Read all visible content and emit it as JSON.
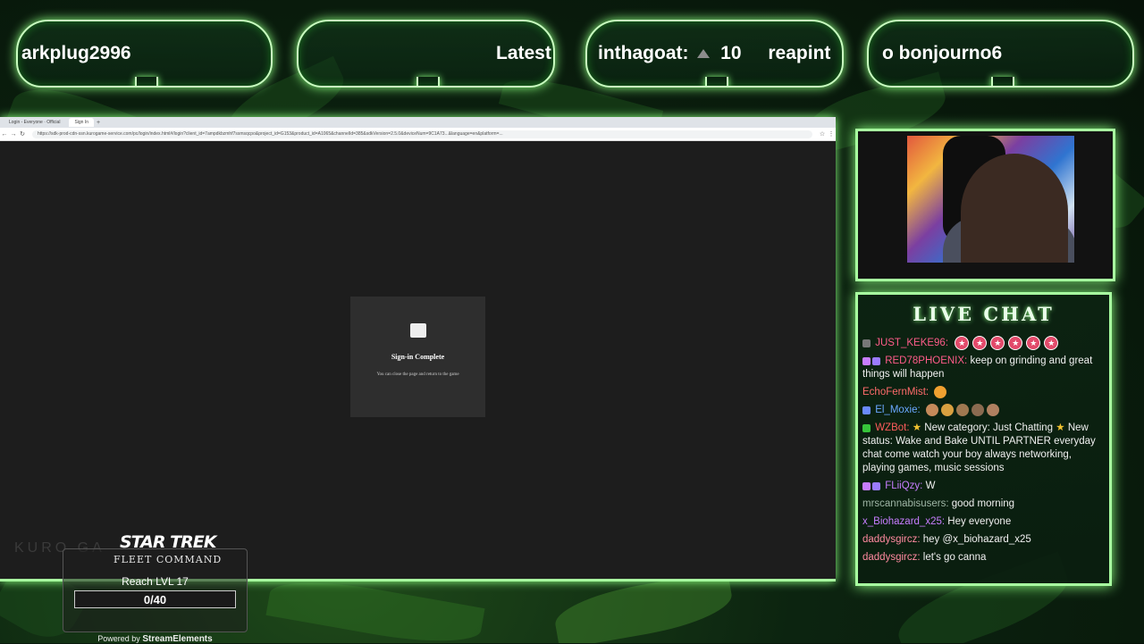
{
  "banners": [
    {
      "text": "arkplug2996"
    },
    {
      "text": "Latest"
    },
    {
      "user": "inthagoat:",
      "count": "10",
      "extra": "reapint"
    },
    {
      "text": "o bonjourno6"
    }
  ],
  "browser": {
    "tabs": [
      "Login - Everyone · Official",
      "Sign In"
    ],
    "url": "https://sdk-prod-cdn-ssn.kurogame-service.com/pc/login/index.html#/login?client_id=7ampdkbzmhf7ssmsqcpo&project_id=G153&product_id=A1065&channelId=385&sdkVersion=2.5.0&deviceNum=9C1A73...&language=en&platform=...",
    "dialog": {
      "title": "Sign-in Complete",
      "message": "You can close the page and return to the game"
    },
    "watermark": "KURO GA"
  },
  "chat": {
    "title": "LIVE CHAT",
    "messages": [
      {
        "user": "JUST_KEKE96:",
        "color": "#ff5c8a",
        "text": "",
        "emotes": 6
      },
      {
        "user": "RED78PHOENIX:",
        "color": "#ff5c8a",
        "text": "keep on grinding and great things will happen"
      },
      {
        "user": "EchoFernMist:",
        "color": "#ff6b6b",
        "text": ""
      },
      {
        "user": "El_Moxie:",
        "color": "#6aa8ff",
        "text": ""
      },
      {
        "user": "WZBot:",
        "color": "#ff5c5c",
        "text": "New category: Just Chatting",
        "text2": "New status: Wake and Bake UNTIL PARTNER everyday chat come watch your boy always networking, playing games, music sessions"
      },
      {
        "user": "FLiiQzy:",
        "color": "#c77dff",
        "text": "W"
      },
      {
        "user": "mrscannabisusers:",
        "color": "#9fb6a6",
        "text": "good morning"
      },
      {
        "user": "x_Biohazard_x25:",
        "color": "#c77dff",
        "text": "Hey everyone"
      },
      {
        "user": "daddysgircz:",
        "color": "#ff8aa0",
        "text": "hey @x_biohazard_x25"
      },
      {
        "user": "daddysgircz:",
        "color": "#ff8aa0",
        "text": "let's go canna"
      }
    ]
  },
  "goal": {
    "logo_line1": "STAR TREK",
    "logo_line2": "FLEET COMMAND",
    "label": "Reach LVL 17",
    "value": "0/40",
    "progress": 0,
    "powered_by": "Powered by",
    "powered_brand": "StreamElements"
  }
}
